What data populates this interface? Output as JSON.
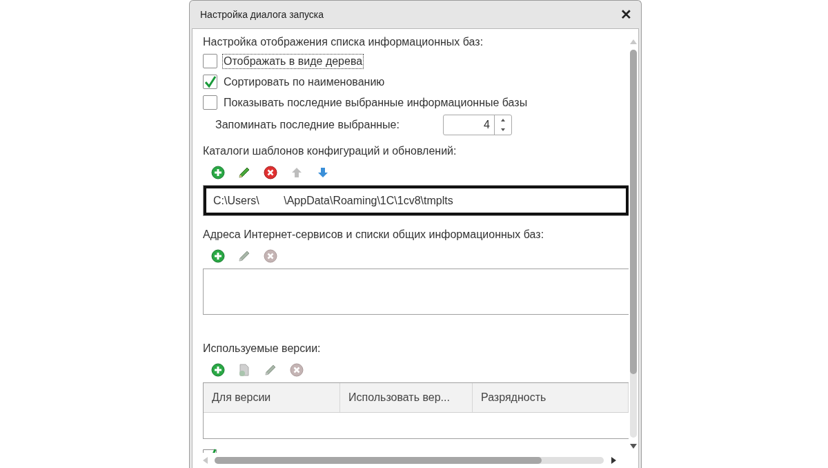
{
  "window": {
    "title": "Настройка диалога запуска",
    "close": "✕"
  },
  "display_section": {
    "heading": "Настройка отображения списка информационных баз:",
    "options": [
      {
        "label": "Отображать в виде дерева",
        "checked": false,
        "focused": true
      },
      {
        "label": "Сортировать по наименованию",
        "checked": true,
        "focused": false
      },
      {
        "label": "Показывать последние выбранные информационные базы",
        "checked": false,
        "focused": false
      }
    ],
    "remember": {
      "label": "Запоминать последние выбранные:",
      "value": "4"
    }
  },
  "templates_section": {
    "heading": "Каталоги шаблонов конфигураций и обновлений:",
    "toolbar": [
      {
        "kind": "add",
        "disabled": false
      },
      {
        "kind": "edit",
        "disabled": false
      },
      {
        "kind": "delete",
        "disabled": false
      },
      {
        "kind": "up",
        "disabled": true
      },
      {
        "kind": "down",
        "disabled": false
      }
    ],
    "rows": [
      {
        "text": "C:\\Users\\        \\AppData\\Roaming\\1C\\1cv8\\tmplts",
        "selected": true
      }
    ]
  },
  "services_section": {
    "heading": "Адреса Интернет-сервисов и списки общих информационных баз:",
    "toolbar": [
      {
        "kind": "add",
        "disabled": false
      },
      {
        "kind": "edit",
        "disabled": true
      },
      {
        "kind": "delete",
        "disabled": true
      }
    ]
  },
  "versions_section": {
    "heading": "Используемые версии:",
    "toolbar": [
      {
        "kind": "add",
        "disabled": false
      },
      {
        "kind": "copy",
        "disabled": true
      },
      {
        "kind": "edit",
        "disabled": true
      },
      {
        "kind": "delete",
        "disabled": true
      }
    ],
    "columns": [
      "Для версии",
      "Использовать вер...",
      "Разрядность"
    ]
  },
  "bottom_checkbox": {
    "checked": true
  }
}
